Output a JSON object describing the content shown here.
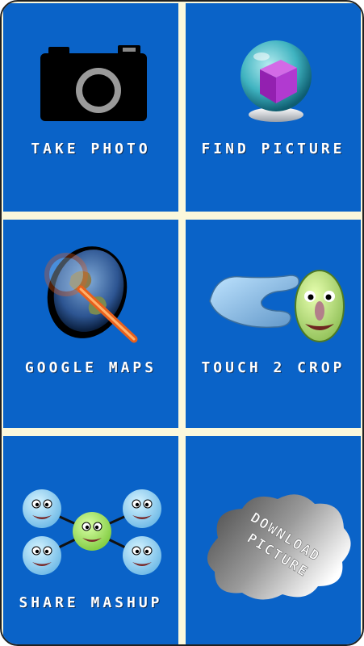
{
  "tiles": {
    "take_photo": {
      "label": "TAKE PHOTO",
      "icon": "camera-icon"
    },
    "find_picture": {
      "label": "FIND PICTURE",
      "icon": "crystal-ball-icon"
    },
    "google_maps": {
      "label": "GOOGLE MAPS",
      "icon": "globe-magnifier-icon"
    },
    "touch_crop": {
      "label": "TOUCH 2 CROP",
      "icon": "hand-pinch-face-icon"
    },
    "share_mashup": {
      "label": "SHARE MASHUP",
      "icon": "face-network-icon"
    },
    "download_picture": {
      "label": "DOWNLOAD PICTURE",
      "line1": "DOWNLOAD",
      "line2": "PICTURE",
      "icon": "cloud-icon"
    }
  },
  "colors": {
    "tile_blue": "#0a63c8",
    "divider": "#fbf8dc",
    "border": "#202020",
    "label": "#ffffff"
  }
}
